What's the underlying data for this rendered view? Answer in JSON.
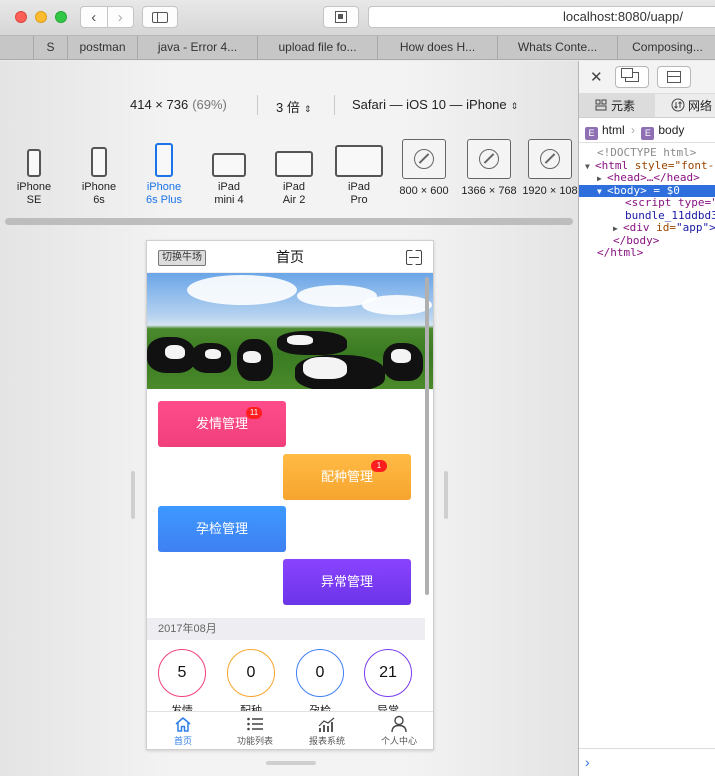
{
  "browser": {
    "url": "localhost:8080/uapp/",
    "back_glyph": "‹",
    "forward_glyph": "›",
    "tabs": [
      {
        "label": "",
        "width": 34
      },
      {
        "label": "S",
        "width": 34
      },
      {
        "label": "postman",
        "width": 70
      },
      {
        "label": "java - Error 4...",
        "width": 120
      },
      {
        "label": "upload file fo...",
        "width": 120
      },
      {
        "label": "How does H...",
        "width": 120
      },
      {
        "label": "Whats Conte...",
        "width": 120
      },
      {
        "label": "Composing...",
        "width": 100
      }
    ]
  },
  "rdm": {
    "size": "414 × 736",
    "zoom_pct": "(69%)",
    "scale": "3 倍",
    "user_agent": "Safari — iOS 10 — iPhone",
    "devices": [
      {
        "line1": "iPhone",
        "line2": "SE",
        "active": false
      },
      {
        "line1": "iPhone",
        "line2": "6s",
        "active": false
      },
      {
        "line1": "iPhone",
        "line2": "6s Plus",
        "active": true
      },
      {
        "line1": "iPad",
        "line2": "mini 4",
        "active": false
      },
      {
        "line1": "iPad",
        "line2": "Air 2",
        "active": false
      },
      {
        "line1": "iPad",
        "line2": "Pro",
        "active": false
      },
      {
        "line1": "800 × 600",
        "line2": "",
        "active": false
      },
      {
        "line1": "1366 × 768",
        "line2": "",
        "active": false
      },
      {
        "line1": "1920 × 108",
        "line2": "",
        "active": false
      }
    ]
  },
  "app": {
    "switch_label": "切换牛场",
    "title": "首页",
    "modules": [
      {
        "label": "发情管理",
        "badge": "11"
      },
      {
        "label": "配种管理",
        "badge": "1"
      },
      {
        "label": "孕检管理",
        "badge": ""
      },
      {
        "label": "异常管理",
        "badge": ""
      }
    ],
    "month": "2017年08月",
    "stats": [
      {
        "value": "5",
        "label": "发情",
        "color": "#f0407c"
      },
      {
        "value": "0",
        "label": "配种",
        "color": "#f6a52e"
      },
      {
        "value": "0",
        "label": "孕检",
        "color": "#3f80f2"
      },
      {
        "value": "21",
        "label": "异常",
        "color": "#7a3cf0"
      }
    ],
    "nav": [
      {
        "label": "首页",
        "icon": "home-icon",
        "active": true
      },
      {
        "label": "功能列表",
        "icon": "list-icon",
        "active": false
      },
      {
        "label": "报表系统",
        "icon": "chart-icon",
        "active": false
      },
      {
        "label": "个人中心",
        "icon": "user-icon",
        "active": false
      }
    ]
  },
  "inspector": {
    "close_glyph": "✕",
    "tab_elements": "元素",
    "tab_network": "网络",
    "crumb_1": "html",
    "crumb_2": "body",
    "crumb_badge": "E",
    "doctype": "<!DOCTYPE html>",
    "html_open_tag": "<html",
    "html_attr": " style=\"font-",
    "head_text": "<head>…</head>",
    "body_open": "<body>",
    "body_eq": " = $0",
    "script_text": "<script type=\"",
    "script_src": "bundle_11ddbd3",
    "div_tag": "<div",
    "div_attr": " id=",
    "div_val": "\"app\">",
    "body_close": "</body>",
    "html_close": "</html>",
    "console_glyph": "›"
  }
}
